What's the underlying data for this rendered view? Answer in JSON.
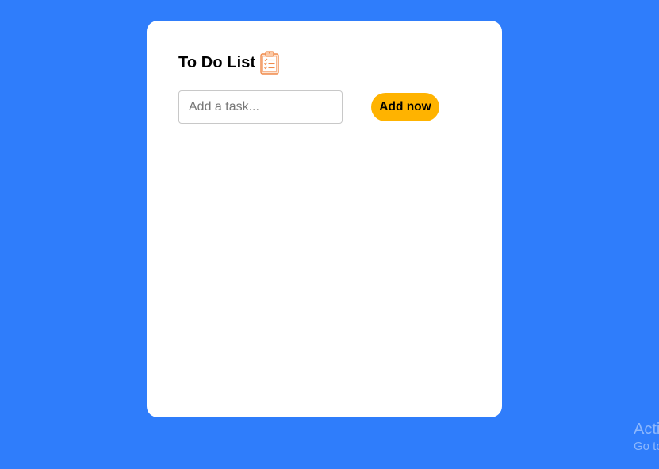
{
  "app": {
    "title": "To Do List",
    "title_icon": "clipboard-checklist-icon"
  },
  "form": {
    "input_value": "",
    "input_placeholder": "Add a task...",
    "add_label": "Add now"
  },
  "tasks": [],
  "watermark": {
    "line1": "Acti",
    "line2": "Go to"
  },
  "colors": {
    "background": "#2f7dfb",
    "card": "#ffffff",
    "button": "#ffb300",
    "icon": "#f4a77a"
  }
}
